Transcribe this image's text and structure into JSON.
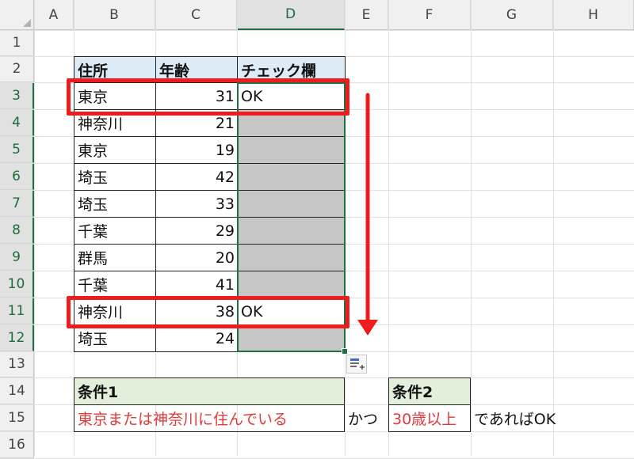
{
  "columns": [
    "A",
    "B",
    "C",
    "D",
    "E",
    "F",
    "G",
    "H"
  ],
  "rows": [
    "1",
    "2",
    "3",
    "4",
    "5",
    "6",
    "7",
    "8",
    "9",
    "10",
    "11",
    "12",
    "13",
    "14",
    "15",
    "16"
  ],
  "table": {
    "headers": [
      "住所",
      "年齢",
      "チェック欄"
    ],
    "rows": [
      {
        "addr": "東京",
        "age": "31",
        "check": "OK"
      },
      {
        "addr": "神奈川",
        "age": "21",
        "check": ""
      },
      {
        "addr": "東京",
        "age": "19",
        "check": ""
      },
      {
        "addr": "埼玉",
        "age": "42",
        "check": ""
      },
      {
        "addr": "埼玉",
        "age": "33",
        "check": ""
      },
      {
        "addr": "千葉",
        "age": "29",
        "check": ""
      },
      {
        "addr": "群馬",
        "age": "20",
        "check": ""
      },
      {
        "addr": "千葉",
        "age": "41",
        "check": ""
      },
      {
        "addr": "神奈川",
        "age": "38",
        "check": "OK"
      },
      {
        "addr": "埼玉",
        "age": "24",
        "check": ""
      }
    ]
  },
  "conditions": {
    "cond1_label": "条件1",
    "cond1_text": "東京または神奈川に住んでいる",
    "and_text": "かつ",
    "cond2_label": "条件2",
    "cond2_text": "30歳以上",
    "result_text": "であればOK"
  },
  "colors": {
    "highlight_red": "#ee1c1c",
    "header_blue": "#ddebf7",
    "header_green": "#e2efda",
    "selection_green": "#1e7145"
  },
  "icons": {
    "paste_options": "paste-options-icon",
    "down_arrow": "down-arrow-icon"
  }
}
